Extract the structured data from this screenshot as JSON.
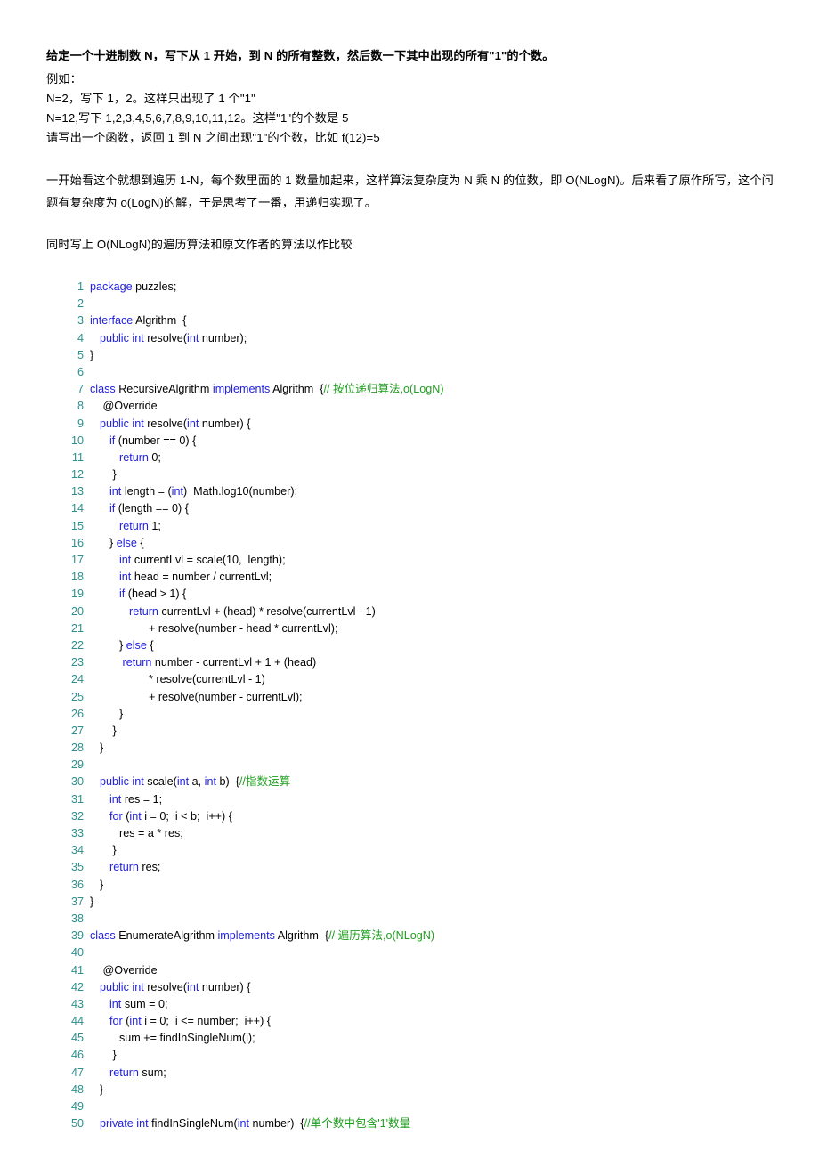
{
  "document": {
    "intro": {
      "heading": "给定一个十进制数 N，写下从 1 开始，到 N 的所有整数，然后数一下其中出现的所有\"1\"的个数。",
      "lines": [
        "例如：",
        "N=2，写下 1，2。这样只出现了 1 个\"1\"",
        "N=12,写下 1,2,3,4,5,6,7,8,9,10,11,12。这样\"1\"的个数是 5",
        "请写出一个函数，返回 1 到 N 之间出现\"1\"的个数，比如 f(12)=5"
      ]
    },
    "paragraphs": [
      "一开始看这个就想到遍历 1-N，每个数里面的 1 数量加起来，这样算法复杂度为 N 乘 N 的位数，即 O(NLogN)。后来看了原作所写，这个问题有复杂度为 o(LogN)的解，于是思考了一番，用递归实现了。",
      "同时写上 O(NLogN)的遍历算法和原文作者的算法以作比较"
    ],
    "colors": {
      "line_number": "#2d8f8f",
      "keyword": "#2121e0",
      "comment": "#1f9e1f",
      "text": "#000000",
      "background": "#ffffff"
    },
    "code": {
      "language": "java",
      "lines": [
        {
          "n": "1",
          "indent": 0,
          "tokens": [
            {
              "t": "package ",
              "c": "kw"
            },
            {
              "t": "puzzles;",
              "c": ""
            }
          ]
        },
        {
          "n": "2",
          "indent": 0,
          "tokens": []
        },
        {
          "n": "3",
          "indent": 0,
          "tokens": [
            {
              "t": "interface ",
              "c": "kw"
            },
            {
              "t": "Algrithm  {",
              "c": ""
            }
          ]
        },
        {
          "n": "4",
          "indent": 1,
          "tokens": [
            {
              "t": "public int ",
              "c": "kw"
            },
            {
              "t": "resolve(",
              "c": ""
            },
            {
              "t": "int ",
              "c": "kw"
            },
            {
              "t": "number);",
              "c": ""
            }
          ]
        },
        {
          "n": "5",
          "indent": 0,
          "tokens": [
            {
              "t": "}",
              "c": ""
            }
          ]
        },
        {
          "n": "6",
          "indent": 0,
          "tokens": []
        },
        {
          "n": "7",
          "indent": 0,
          "tokens": [
            {
              "t": "class ",
              "c": "kw"
            },
            {
              "t": "RecursiveAlgrithm ",
              "c": ""
            },
            {
              "t": "implements ",
              "c": "kw"
            },
            {
              "t": "Algrithm  {",
              "c": ""
            },
            {
              "t": "// 按位递归算法,o(LogN)",
              "c": "cm"
            }
          ]
        },
        {
          "n": "8",
          "indent": 1,
          "tokens": [
            {
              "t": " @Override",
              "c": ""
            }
          ]
        },
        {
          "n": "9",
          "indent": 1,
          "tokens": [
            {
              "t": "public int ",
              "c": "kw"
            },
            {
              "t": "resolve(",
              "c": ""
            },
            {
              "t": "int ",
              "c": "kw"
            },
            {
              "t": "number) {",
              "c": ""
            }
          ]
        },
        {
          "n": "10",
          "indent": 2,
          "tokens": [
            {
              "t": "if ",
              "c": "kw"
            },
            {
              "t": "(number == 0) {",
              "c": ""
            }
          ]
        },
        {
          "n": "11",
          "indent": 3,
          "tokens": [
            {
              "t": "return ",
              "c": "kw"
            },
            {
              "t": "0;",
              "c": ""
            }
          ]
        },
        {
          "n": "12",
          "indent": 2,
          "tokens": [
            {
              "t": " }",
              "c": ""
            }
          ]
        },
        {
          "n": "13",
          "indent": 2,
          "tokens": [
            {
              "t": "int ",
              "c": "kw"
            },
            {
              "t": "length = (",
              "c": ""
            },
            {
              "t": "int",
              "c": "kw"
            },
            {
              "t": ")  Math.log10(number);",
              "c": ""
            }
          ]
        },
        {
          "n": "14",
          "indent": 2,
          "tokens": [
            {
              "t": "if ",
              "c": "kw"
            },
            {
              "t": "(length == 0) {",
              "c": ""
            }
          ]
        },
        {
          "n": "15",
          "indent": 3,
          "tokens": [
            {
              "t": "return ",
              "c": "kw"
            },
            {
              "t": "1;",
              "c": ""
            }
          ]
        },
        {
          "n": "16",
          "indent": 2,
          "tokens": [
            {
              "t": "} ",
              "c": ""
            },
            {
              "t": "else ",
              "c": "kw"
            },
            {
              "t": "{",
              "c": ""
            }
          ]
        },
        {
          "n": "17",
          "indent": 3,
          "tokens": [
            {
              "t": "int ",
              "c": "kw"
            },
            {
              "t": "currentLvl = scale(10,  length);",
              "c": ""
            }
          ]
        },
        {
          "n": "18",
          "indent": 3,
          "tokens": [
            {
              "t": "int ",
              "c": "kw"
            },
            {
              "t": "head = number / currentLvl;",
              "c": ""
            }
          ]
        },
        {
          "n": "19",
          "indent": 3,
          "tokens": [
            {
              "t": "if ",
              "c": "kw"
            },
            {
              "t": "(head > 1) {",
              "c": ""
            }
          ]
        },
        {
          "n": "20",
          "indent": 4,
          "tokens": [
            {
              "t": "return ",
              "c": "kw"
            },
            {
              "t": "currentLvl + (head) * resolve(currentLvl - 1)",
              "c": ""
            }
          ]
        },
        {
          "n": "21",
          "indent": 6,
          "tokens": [
            {
              "t": "+ resolve(number - head * currentLvl);",
              "c": ""
            }
          ]
        },
        {
          "n": "22",
          "indent": 3,
          "tokens": [
            {
              "t": "} ",
              "c": ""
            },
            {
              "t": "else ",
              "c": "kw"
            },
            {
              "t": "{",
              "c": ""
            }
          ]
        },
        {
          "n": "23",
          "indent": 3,
          "tokens": [
            {
              "t": " ",
              "c": ""
            },
            {
              "t": "return ",
              "c": "kw"
            },
            {
              "t": "number - currentLvl + 1 + (head)",
              "c": ""
            }
          ]
        },
        {
          "n": "24",
          "indent": 6,
          "tokens": [
            {
              "t": "* resolve(currentLvl - 1)",
              "c": ""
            }
          ]
        },
        {
          "n": "25",
          "indent": 6,
          "tokens": [
            {
              "t": "+ resolve(number - currentLvl);",
              "c": ""
            }
          ]
        },
        {
          "n": "26",
          "indent": 3,
          "tokens": [
            {
              "t": "}",
              "c": ""
            }
          ]
        },
        {
          "n": "27",
          "indent": 2,
          "tokens": [
            {
              "t": " }",
              "c": ""
            }
          ]
        },
        {
          "n": "28",
          "indent": 1,
          "tokens": [
            {
              "t": "}",
              "c": ""
            }
          ]
        },
        {
          "n": "29",
          "indent": 0,
          "tokens": []
        },
        {
          "n": "30",
          "indent": 1,
          "tokens": [
            {
              "t": "public int ",
              "c": "kw"
            },
            {
              "t": "scale(",
              "c": ""
            },
            {
              "t": "int ",
              "c": "kw"
            },
            {
              "t": "a, ",
              "c": ""
            },
            {
              "t": "int ",
              "c": "kw"
            },
            {
              "t": "b)  {",
              "c": ""
            },
            {
              "t": "//指数运算",
              "c": "cm"
            }
          ]
        },
        {
          "n": "31",
          "indent": 2,
          "tokens": [
            {
              "t": "int ",
              "c": "kw"
            },
            {
              "t": "res = 1;",
              "c": ""
            }
          ]
        },
        {
          "n": "32",
          "indent": 2,
          "tokens": [
            {
              "t": "for ",
              "c": "kw"
            },
            {
              "t": "(",
              "c": ""
            },
            {
              "t": "int ",
              "c": "kw"
            },
            {
              "t": "i = 0;  i < b;  i++) {",
              "c": ""
            }
          ]
        },
        {
          "n": "33",
          "indent": 3,
          "tokens": [
            {
              "t": "res = a * res;",
              "c": ""
            }
          ]
        },
        {
          "n": "34",
          "indent": 2,
          "tokens": [
            {
              "t": " }",
              "c": ""
            }
          ]
        },
        {
          "n": "35",
          "indent": 2,
          "tokens": [
            {
              "t": "return ",
              "c": "kw"
            },
            {
              "t": "res;",
              "c": ""
            }
          ]
        },
        {
          "n": "36",
          "indent": 1,
          "tokens": [
            {
              "t": "}",
              "c": ""
            }
          ]
        },
        {
          "n": "37",
          "indent": 0,
          "tokens": [
            {
              "t": "}",
              "c": ""
            }
          ]
        },
        {
          "n": "38",
          "indent": 0,
          "tokens": []
        },
        {
          "n": "39",
          "indent": 0,
          "tokens": [
            {
              "t": "class ",
              "c": "kw"
            },
            {
              "t": "EnumerateAlgrithm ",
              "c": ""
            },
            {
              "t": "implements ",
              "c": "kw"
            },
            {
              "t": "Algrithm  {",
              "c": ""
            },
            {
              "t": "// 遍历算法,o(NLogN)",
              "c": "cm"
            }
          ]
        },
        {
          "n": "40",
          "indent": 0,
          "tokens": []
        },
        {
          "n": "41",
          "indent": 1,
          "tokens": [
            {
              "t": " @Override",
              "c": ""
            }
          ]
        },
        {
          "n": "42",
          "indent": 1,
          "tokens": [
            {
              "t": "public int ",
              "c": "kw"
            },
            {
              "t": "resolve(",
              "c": ""
            },
            {
              "t": "int ",
              "c": "kw"
            },
            {
              "t": "number) {",
              "c": ""
            }
          ]
        },
        {
          "n": "43",
          "indent": 2,
          "tokens": [
            {
              "t": "int ",
              "c": "kw"
            },
            {
              "t": "sum = 0;",
              "c": ""
            }
          ]
        },
        {
          "n": "44",
          "indent": 2,
          "tokens": [
            {
              "t": "for ",
              "c": "kw"
            },
            {
              "t": "(",
              "c": ""
            },
            {
              "t": "int ",
              "c": "kw"
            },
            {
              "t": "i = 0;  i <= number;  i++) {",
              "c": ""
            }
          ]
        },
        {
          "n": "45",
          "indent": 3,
          "tokens": [
            {
              "t": "sum += findInSingleNum(i);",
              "c": ""
            }
          ]
        },
        {
          "n": "46",
          "indent": 2,
          "tokens": [
            {
              "t": " }",
              "c": ""
            }
          ]
        },
        {
          "n": "47",
          "indent": 2,
          "tokens": [
            {
              "t": "return ",
              "c": "kw"
            },
            {
              "t": "sum;",
              "c": ""
            }
          ]
        },
        {
          "n": "48",
          "indent": 1,
          "tokens": [
            {
              "t": "}",
              "c": ""
            }
          ]
        },
        {
          "n": "49",
          "indent": 0,
          "tokens": []
        },
        {
          "n": "50",
          "indent": 1,
          "tokens": [
            {
              "t": "private int ",
              "c": "kw"
            },
            {
              "t": "findInSingleNum(",
              "c": ""
            },
            {
              "t": "int ",
              "c": "kw"
            },
            {
              "t": "number)  {",
              "c": ""
            },
            {
              "t": "//单个数中包含'1'数量",
              "c": "cm"
            }
          ]
        }
      ]
    }
  }
}
